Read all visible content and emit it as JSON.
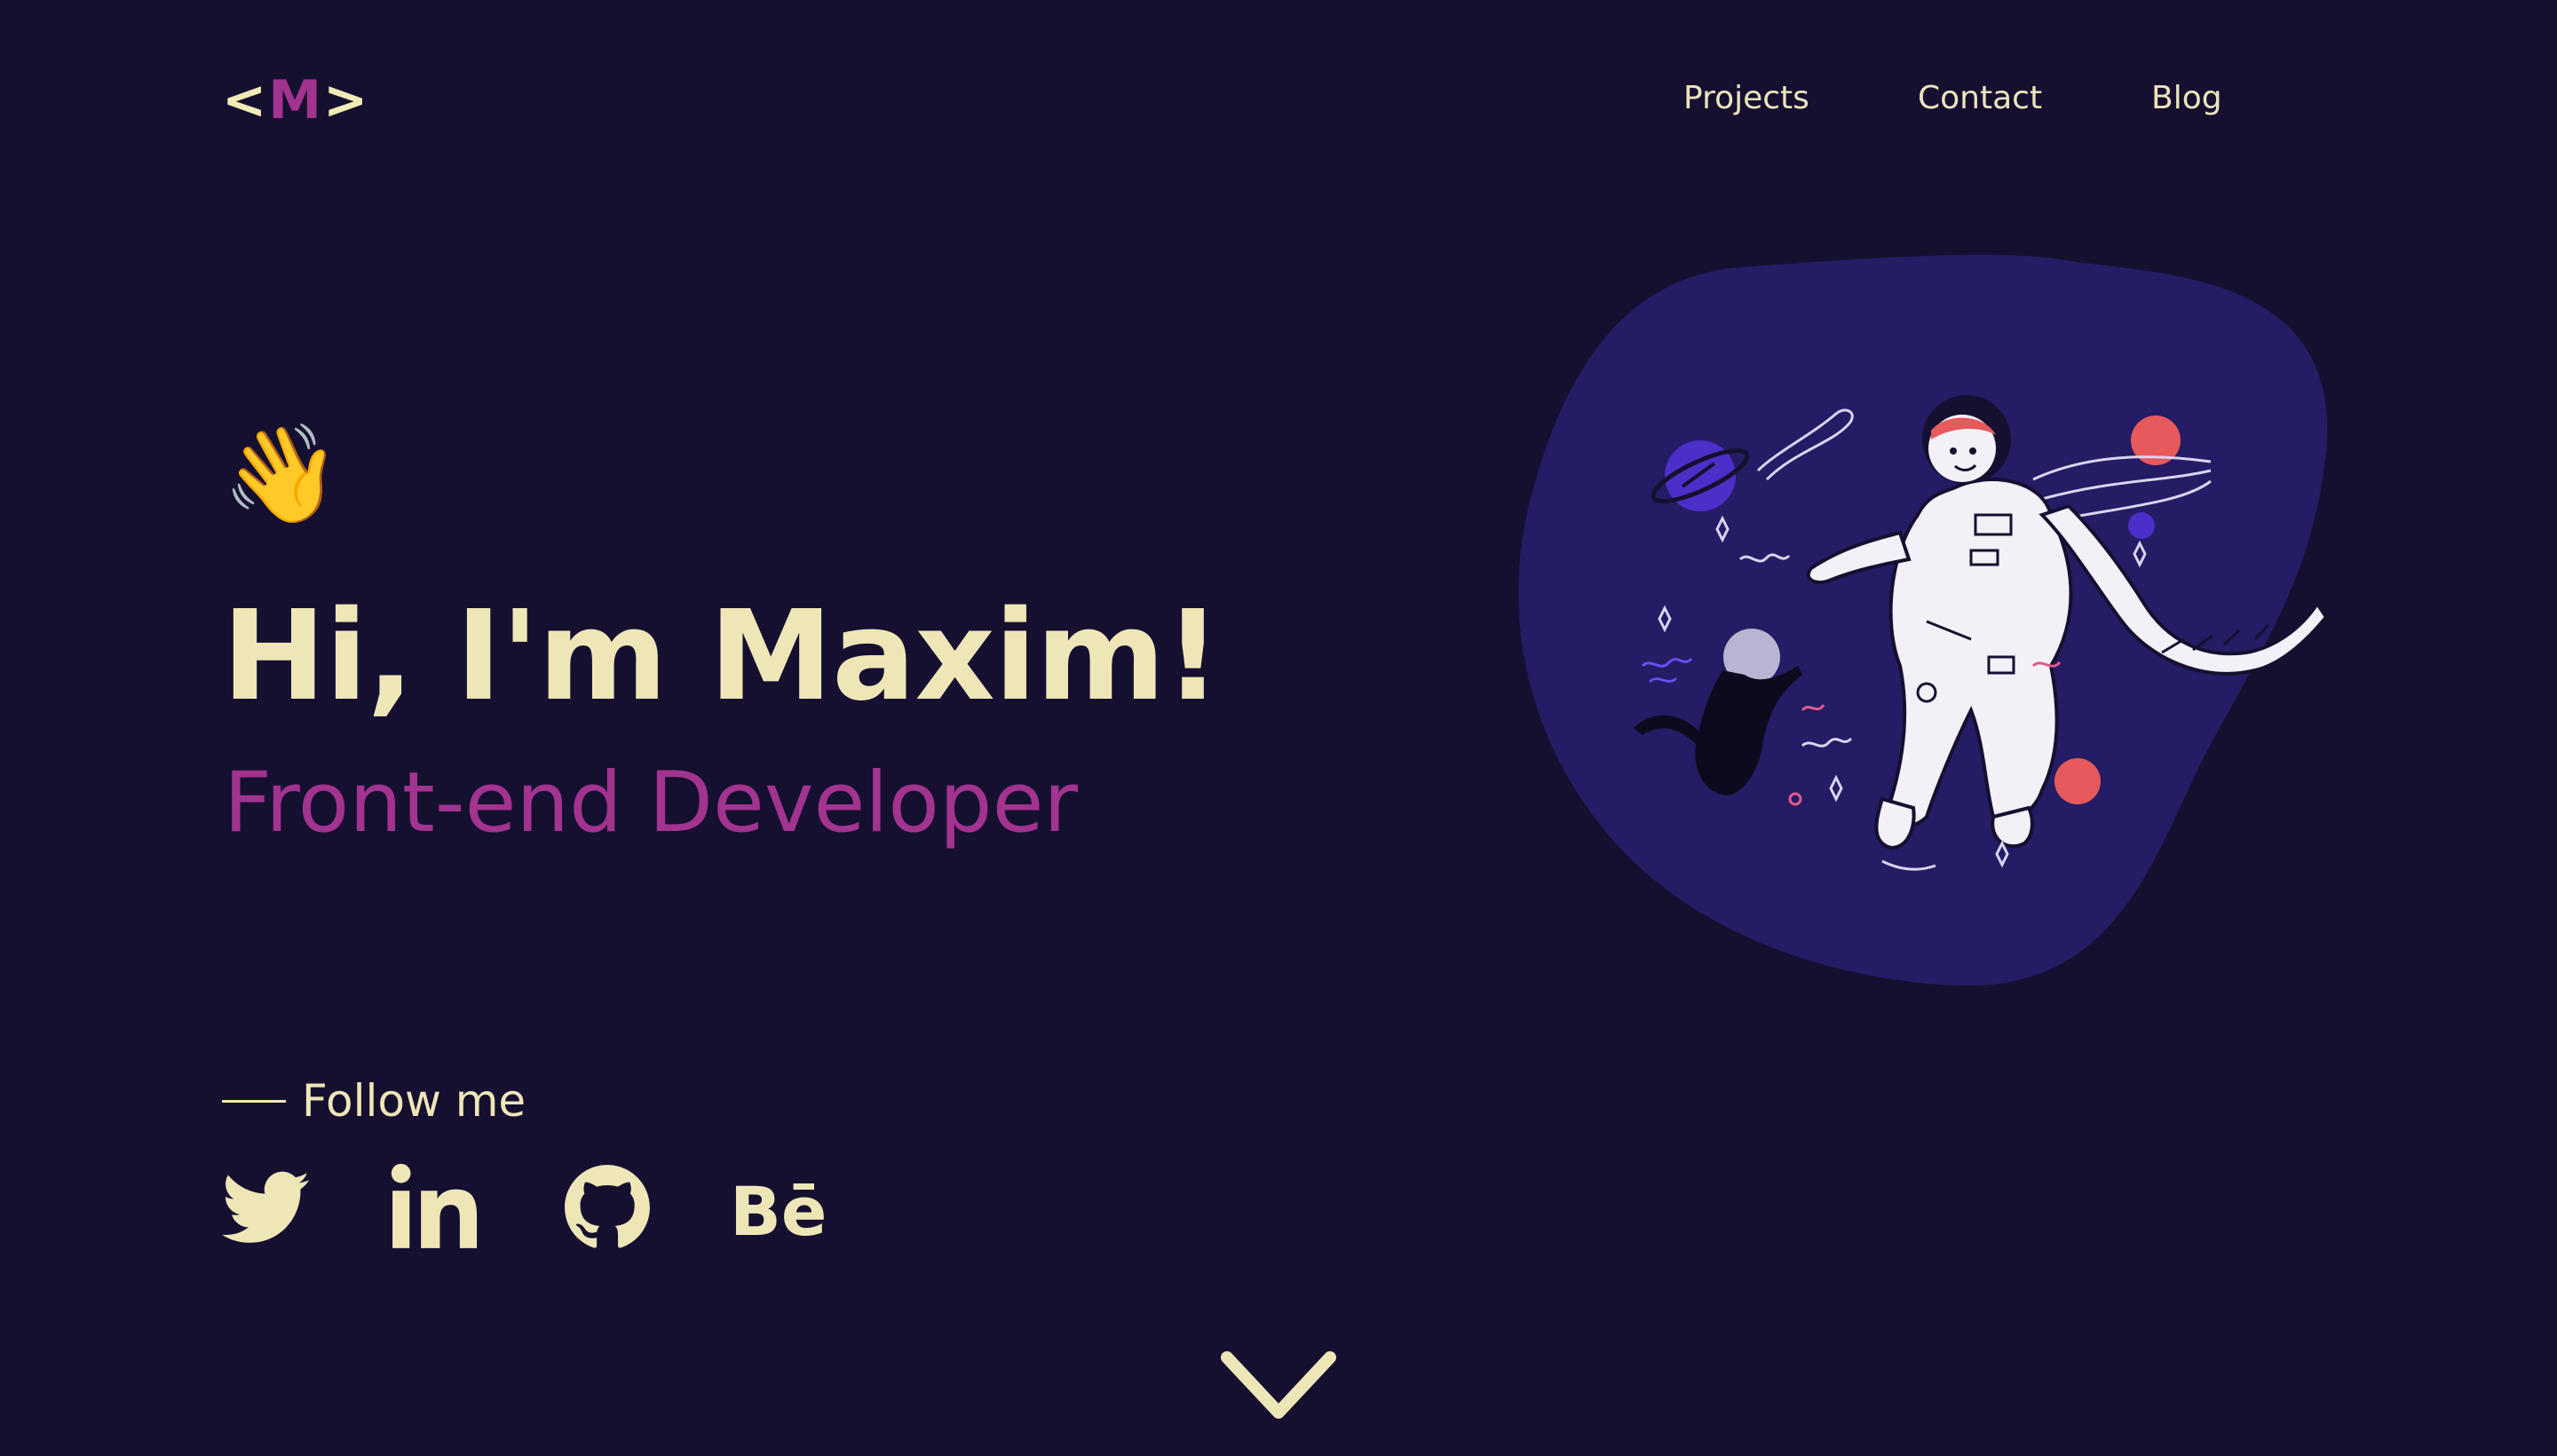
{
  "header": {
    "logo": {
      "open": "<",
      "letter": "M",
      "close": ">"
    },
    "nav": [
      "Projects",
      "Contact",
      "Blog"
    ]
  },
  "hero": {
    "emoji": "👋",
    "title": "Hi, I'm Maxim!",
    "subtitle": "Front-end Developer"
  },
  "social": {
    "follow_label": "Follow me",
    "links": [
      {
        "icon": "twitter-icon"
      },
      {
        "icon": "linkedin-icon"
      },
      {
        "icon": "github-icon"
      },
      {
        "icon": "behance-icon",
        "text": "Bē"
      }
    ]
  },
  "scroll": {
    "icon": "chevron-down-icon"
  },
  "colors": {
    "background": "#151030",
    "text": "#efe6b8",
    "accent": "#a2338f",
    "blob": "#241c64"
  }
}
